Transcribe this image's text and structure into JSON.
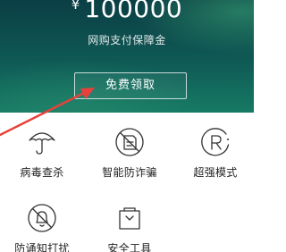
{
  "promo": {
    "currency": "¥",
    "amount": "100000",
    "subtitle": "网购支付保障金",
    "claim_label": "免费领取"
  },
  "features": [
    {
      "label": "病毒查杀",
      "icon": "umbrella-icon"
    },
    {
      "label": "智能防诈骗",
      "icon": "scam-block-icon"
    },
    {
      "label": "超强模式",
      "icon": "r-mode-icon"
    },
    {
      "label": "防诵知打扰",
      "icon": "notification-block-icon"
    },
    {
      "label": "安全工具",
      "icon": "toolbox-icon"
    }
  ],
  "colors": {
    "hero_top": "#0b3e45",
    "hero_bottom": "#167a64",
    "annotation_arrow": "#e8413c",
    "icon_stroke": "#333333"
  }
}
